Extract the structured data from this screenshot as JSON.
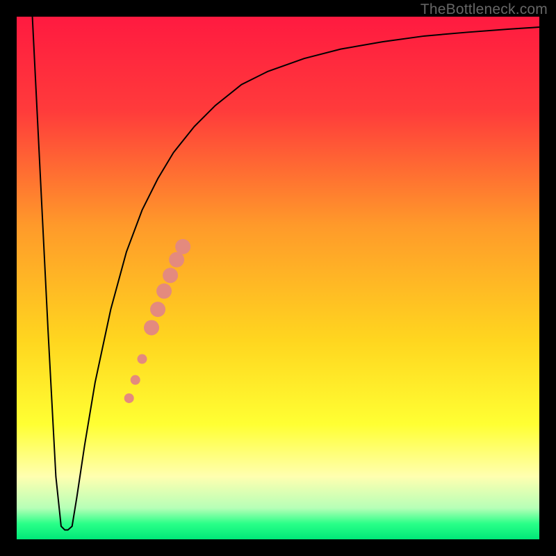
{
  "watermark": "TheBottleneck.com",
  "chart_data": {
    "type": "line",
    "title": "",
    "xlabel": "",
    "ylabel": "",
    "xlim": [
      0,
      100
    ],
    "ylim": [
      0,
      100
    ],
    "background_gradient": {
      "stops": [
        {
          "offset": 0.0,
          "color": "#ff1a40"
        },
        {
          "offset": 0.18,
          "color": "#ff3b3b"
        },
        {
          "offset": 0.4,
          "color": "#ff9a2a"
        },
        {
          "offset": 0.62,
          "color": "#ffd61f"
        },
        {
          "offset": 0.78,
          "color": "#ffff33"
        },
        {
          "offset": 0.88,
          "color": "#ffffb0"
        },
        {
          "offset": 0.94,
          "color": "#b7ffb7"
        },
        {
          "offset": 0.97,
          "color": "#2aff88"
        },
        {
          "offset": 1.0,
          "color": "#00e878"
        }
      ]
    },
    "series": [
      {
        "name": "bottleneck-curve",
        "color": "#000000",
        "stroke_width": 2,
        "x": [
          3.0,
          4.5,
          6.0,
          7.5,
          8.5,
          9.2,
          9.8,
          10.6,
          11.5,
          13.0,
          15.0,
          18.0,
          21.0,
          24.0,
          27.0,
          30.0,
          34.0,
          38.0,
          43.0,
          48.0,
          55.0,
          62.0,
          70.0,
          78.0,
          86.0,
          94.0,
          100.0
        ],
        "y": [
          100.0,
          70.0,
          40.0,
          12.0,
          2.5,
          1.8,
          1.8,
          2.5,
          8.0,
          18.0,
          30.0,
          44.0,
          55.0,
          63.0,
          69.0,
          74.0,
          79.0,
          83.0,
          87.0,
          89.5,
          92.0,
          93.8,
          95.2,
          96.3,
          97.0,
          97.6,
          98.0
        ]
      }
    ],
    "markers": {
      "name": "highlight-points",
      "color": "#e48a7e",
      "points": [
        {
          "x": 21.5,
          "y": 27.0,
          "r": 7
        },
        {
          "x": 22.7,
          "y": 30.5,
          "r": 7
        },
        {
          "x": 24.0,
          "y": 34.5,
          "r": 7
        },
        {
          "x": 25.8,
          "y": 40.5,
          "r": 11
        },
        {
          "x": 27.0,
          "y": 44.0,
          "r": 11
        },
        {
          "x": 28.2,
          "y": 47.5,
          "r": 11
        },
        {
          "x": 29.4,
          "y": 50.5,
          "r": 11
        },
        {
          "x": 30.6,
          "y": 53.5,
          "r": 11
        },
        {
          "x": 31.8,
          "y": 56.0,
          "r": 11
        }
      ]
    }
  }
}
